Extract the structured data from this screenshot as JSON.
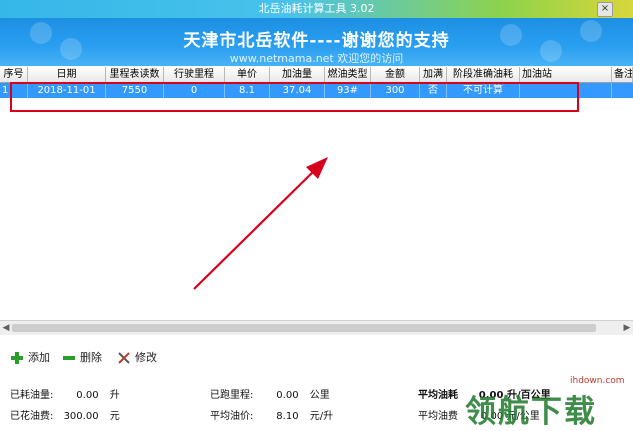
{
  "window": {
    "title": "北岳油耗计算工具 3.02",
    "close_glyph": "×"
  },
  "banner": {
    "title": "天津市北岳软件----谢谢您的支持",
    "subtitle": "www.netmama.net 欢迎您的访问"
  },
  "table": {
    "headers": [
      "序号",
      "日期",
      "里程表读数",
      "行驶里程",
      "单价",
      "加油量",
      "燃油类型",
      "金额",
      "加满",
      "阶段准确油耗",
      "加油站",
      "备注"
    ],
    "rows": [
      [
        "1",
        "2018-11-01",
        "7550",
        "0",
        "8.1",
        "37.04",
        "93#",
        "300",
        "否",
        "不可计算",
        "",
        ""
      ]
    ]
  },
  "toolbar": {
    "add": "添加",
    "delete": "删除",
    "edit": "修改"
  },
  "stats": {
    "fuel_used_label": "已耗油量:",
    "fuel_used_value": "0.00",
    "fuel_used_unit": "升",
    "cost_label": "已花油费:",
    "cost_value": "300.00",
    "cost_unit": "元",
    "distance_label": "已跑里程:",
    "distance_value": "0.00",
    "distance_unit": "公里",
    "avg_price_label": "平均油价:",
    "avg_price_value": "8.10",
    "avg_price_unit": "元/升",
    "avg_consumption_label": "平均油耗",
    "avg_consumption_value": "0.00",
    "avg_consumption_unit": "升/百公里",
    "avg_cost_label": "平均油费",
    "avg_cost_value": "0.00",
    "avg_cost_unit": "元/公里"
  },
  "watermark": {
    "site": "ihdown.com",
    "brand": "领航下载"
  },
  "colors": {
    "selection": "#3399ff",
    "highlight_box": "#d9001b",
    "arrow": "#d9001b"
  }
}
